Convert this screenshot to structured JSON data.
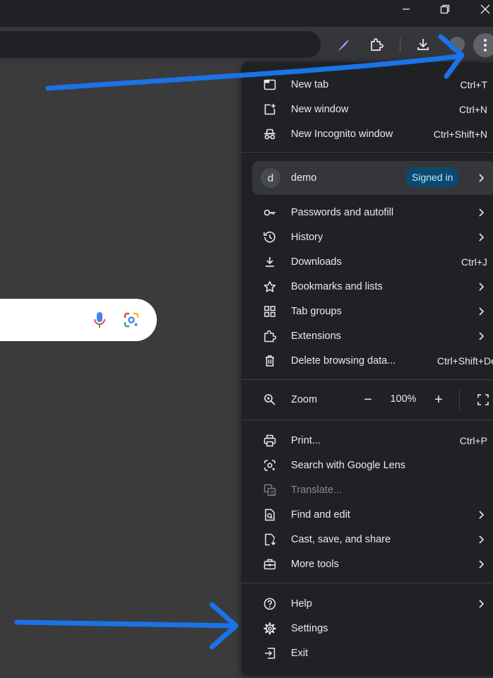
{
  "menu": {
    "items_top": [
      {
        "label": "New tab",
        "shortcut": "Ctrl+T",
        "icon": "new-tab-icon"
      },
      {
        "label": "New window",
        "shortcut": "Ctrl+N",
        "icon": "new-window-icon"
      },
      {
        "label": "New Incognito window",
        "shortcut": "Ctrl+Shift+N",
        "icon": "incognito-icon"
      }
    ],
    "profile": {
      "initial": "d",
      "name": "demo",
      "status": "Signed in"
    },
    "items_mid": [
      {
        "label": "Passwords and autofill",
        "icon": "key-icon",
        "submenu": true
      },
      {
        "label": "History",
        "icon": "history-icon",
        "submenu": true
      },
      {
        "label": "Downloads",
        "shortcut": "Ctrl+J",
        "icon": "download-icon"
      },
      {
        "label": "Bookmarks and lists",
        "icon": "star-icon",
        "submenu": true
      },
      {
        "label": "Tab groups",
        "icon": "tab-groups-icon",
        "submenu": true
      },
      {
        "label": "Extensions",
        "icon": "puzzle-icon",
        "submenu": true
      },
      {
        "label": "Delete browsing data...",
        "shortcut": "Ctrl+Shift+Del",
        "icon": "trash-icon"
      }
    ],
    "zoom": {
      "label": "Zoom",
      "value": "100%",
      "minus": "−",
      "plus": "+"
    },
    "items_tools": [
      {
        "label": "Print...",
        "shortcut": "Ctrl+P",
        "icon": "print-icon"
      },
      {
        "label": "Search with Google Lens",
        "icon": "lens-icon"
      },
      {
        "label": "Translate...",
        "icon": "translate-icon",
        "disabled": true
      },
      {
        "label": "Find and edit",
        "icon": "find-icon",
        "submenu": true
      },
      {
        "label": "Cast, save, and share",
        "icon": "cast-save-icon",
        "submenu": true
      },
      {
        "label": "More tools",
        "icon": "toolbox-icon",
        "submenu": true
      }
    ],
    "items_bottom": [
      {
        "label": "Help",
        "icon": "help-icon",
        "submenu": true
      },
      {
        "label": "Settings",
        "icon": "gear-icon"
      },
      {
        "label": "Exit",
        "icon": "exit-icon"
      }
    ]
  },
  "colors": {
    "menu_bg": "#202124",
    "accent_pill": "#0b4a6f",
    "arrow": "#1a73e8",
    "page_bg": "#3b3b3b"
  }
}
